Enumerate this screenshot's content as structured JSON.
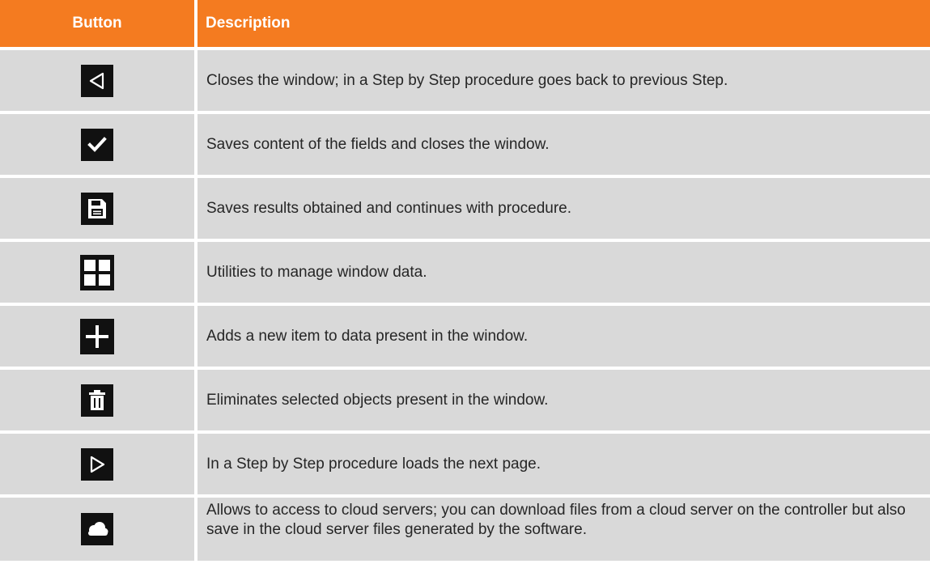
{
  "header": {
    "button_label": "Button",
    "description_label": "Description"
  },
  "colors": {
    "header_bg": "#f47b20",
    "row_bg": "#d9d9d9",
    "icon_bg": "#111111",
    "icon_fg": "#ffffff"
  },
  "rows": [
    {
      "icon": "back-triangle-icon",
      "description": "Closes the window; in a Step by Step procedure goes back to previous Step."
    },
    {
      "icon": "checkmark-icon",
      "description": "Saves content of the fields and closes the window."
    },
    {
      "icon": "save-disk-icon",
      "description": "Saves results obtained and continues with procedure."
    },
    {
      "icon": "grid-icon",
      "description": "Utilities to manage window data."
    },
    {
      "icon": "plus-icon",
      "description": "Adds a new item to data present in the window."
    },
    {
      "icon": "trash-icon",
      "description": "Eliminates selected objects present in the window."
    },
    {
      "icon": "next-triangle-icon",
      "description": "In a Step by Step procedure loads the next page."
    },
    {
      "icon": "cloud-icon",
      "description": "Allows to access to cloud servers; you can download files from a cloud server on the controller but also save in the cloud server files generated by the software."
    }
  ]
}
